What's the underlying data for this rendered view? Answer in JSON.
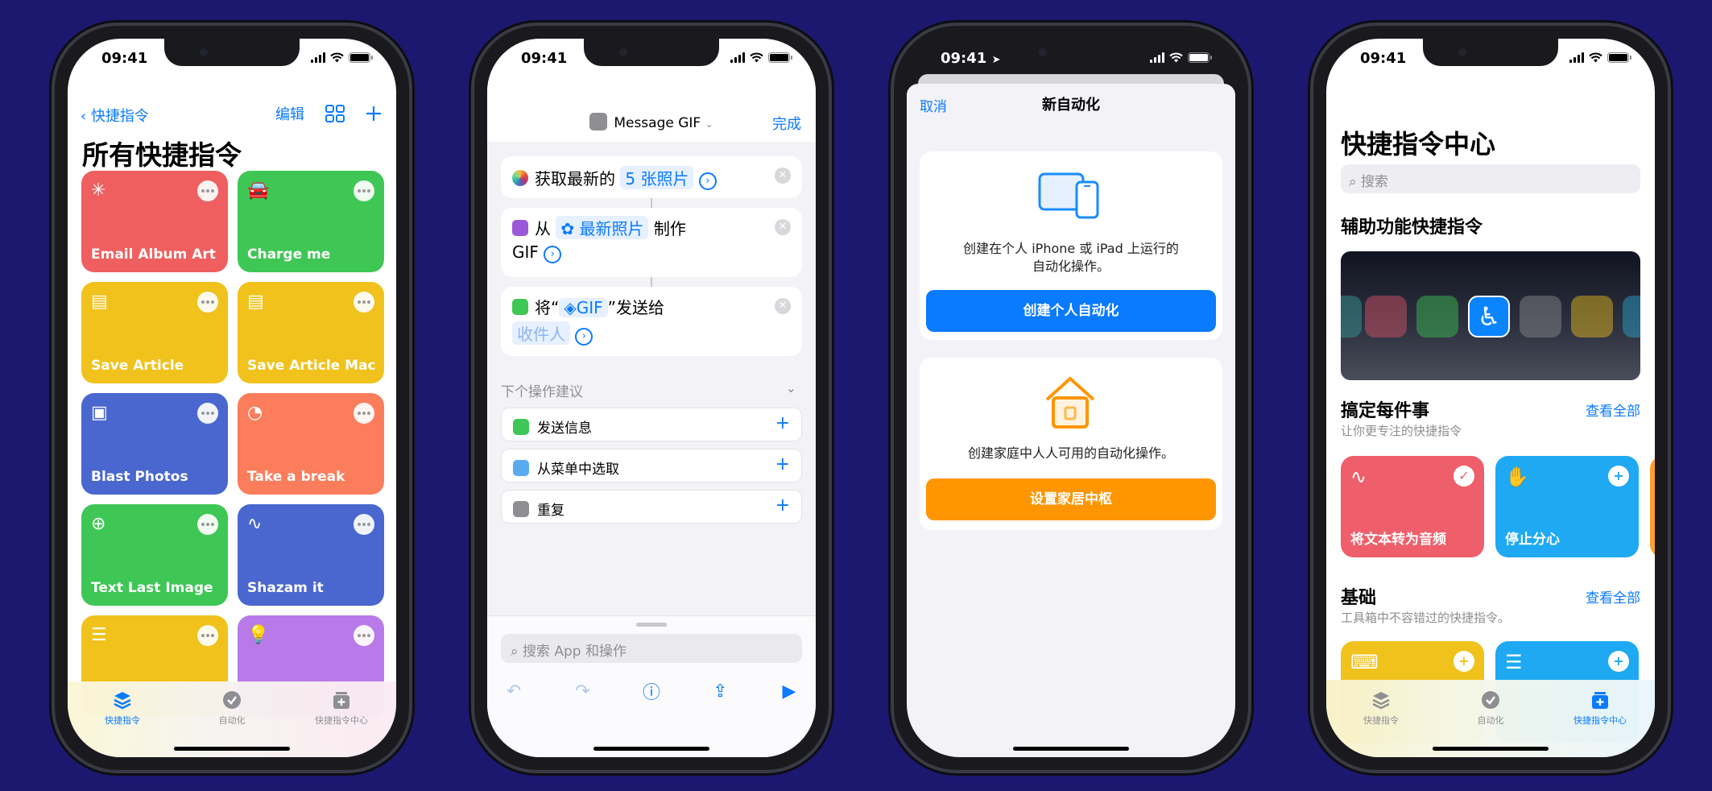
{
  "status": {
    "time": "09:41"
  },
  "phone1": {
    "back_label": "快捷指令",
    "edit_label": "编辑",
    "title": "所有快捷指令",
    "cards": [
      {
        "label": "Email Album Art",
        "color": "#ef5f5f",
        "icon": "sparkle-icon"
      },
      {
        "label": "Charge me",
        "color": "#3ec754",
        "icon": "car-icon"
      },
      {
        "label": "Save Article",
        "color": "#f0c21b",
        "icon": "article-icon"
      },
      {
        "label": "Save Article Mac",
        "color": "#f0c21b",
        "icon": "article-icon"
      },
      {
        "label": "Blast Photos",
        "color": "#4a67cf",
        "icon": "photo-icon"
      },
      {
        "label": "Take a break",
        "color": "#fb7d5c",
        "icon": "timer-icon"
      },
      {
        "label": "Text Last Image",
        "color": "#3ec754",
        "icon": "message-plus-icon"
      },
      {
        "label": "Shazam it",
        "color": "#4a67cf",
        "icon": "waveform-icon"
      },
      {
        "label": "",
        "color": "#f0c21b",
        "icon": "sliders-icon"
      },
      {
        "label": "",
        "color": "#b87ae8",
        "icon": "lightbulb-icon"
      }
    ],
    "tabs": [
      "快捷指令",
      "自动化",
      "快捷指令中心"
    ]
  },
  "phone2": {
    "shortcut_name": "Message GIF",
    "done_label": "完成",
    "action1": {
      "prefix": "获取最新的",
      "token": "5 张照片"
    },
    "action2": {
      "prefix": "从",
      "token": "最新照片",
      "suffix": "制作",
      "line2": "GIF"
    },
    "action3": {
      "prefix": "将“",
      "token": "GIF",
      "suffix": "”发送给",
      "placeholder": "收件人"
    },
    "suggestions_header": "下个操作建议",
    "suggestions": [
      {
        "label": "发送信息",
        "color": "#3ec754"
      },
      {
        "label": "从菜单中选取",
        "color": "#5aaaf0"
      },
      {
        "label": "重复",
        "color": "#8e8e93"
      }
    ],
    "search_placeholder": "搜索 App 和操作"
  },
  "phone3": {
    "cancel_label": "取消",
    "title": "新自动化",
    "personal_desc_1": "创建在个人 iPhone 或 iPad 上运行的",
    "personal_desc_2": "自动化操作。",
    "personal_button": "创建个人自动化",
    "home_desc": "创建家庭中人人可用的自动化操作。",
    "home_button": "设置家居中枢",
    "accent_blue": "#0a7aff",
    "accent_orange": "#ff9500"
  },
  "phone4": {
    "title": "快捷指令中心",
    "search_placeholder": "搜索",
    "section1": "辅助功能快捷指令",
    "section2": {
      "title": "搞定每件事",
      "subtitle": "让你更专注的快捷指令",
      "see_all": "查看全部"
    },
    "cards2": [
      {
        "label": "将文本转为音频",
        "color": "#ef5f6b"
      },
      {
        "label": "停止分心",
        "color": "#1fa9f2"
      }
    ],
    "section3": {
      "title": "基础",
      "subtitle": "工具箱中不容错过的快捷指令。",
      "see_all": "查看全部"
    },
    "tabs": [
      "快捷指令",
      "自动化",
      "快捷指令中心"
    ]
  }
}
